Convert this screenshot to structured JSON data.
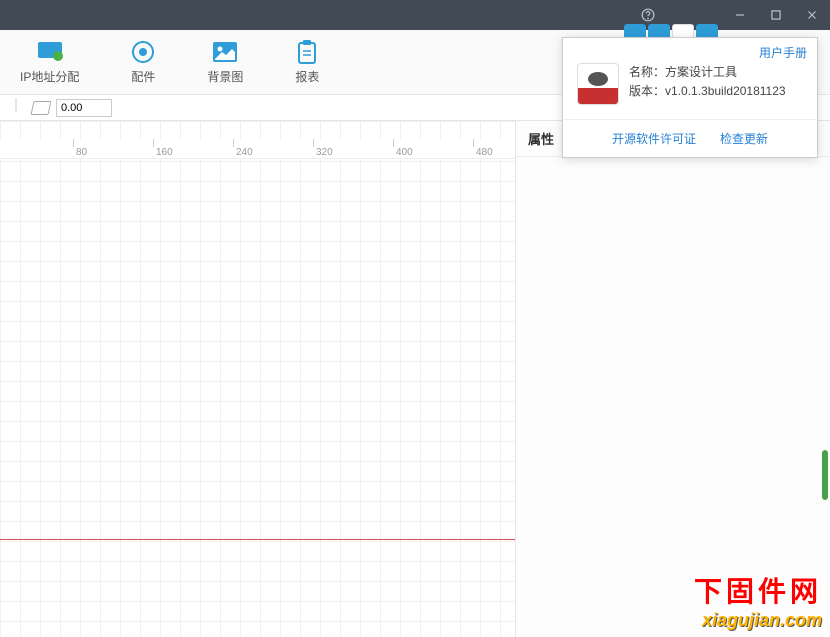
{
  "toolbar": {
    "ip_label": "IP地址分配",
    "parts_label": "配件",
    "bg_label": "背景图",
    "report_label": "报表"
  },
  "subtool": {
    "size_value": "0.00"
  },
  "ruler": {
    "ticks": [
      80,
      160,
      240,
      320,
      400,
      480
    ]
  },
  "sidebar": {
    "prop_title": "属性"
  },
  "popup": {
    "manual": "用户手册",
    "name_label": "名称：",
    "name_value": "方案设计工具",
    "version_label": "版本：",
    "version_value": "v1.0.1.3build20181123",
    "license": "开源软件许可证",
    "update": "检查更新"
  },
  "watermark": {
    "line1": "下固件网",
    "line2": "xiagujian.com"
  }
}
